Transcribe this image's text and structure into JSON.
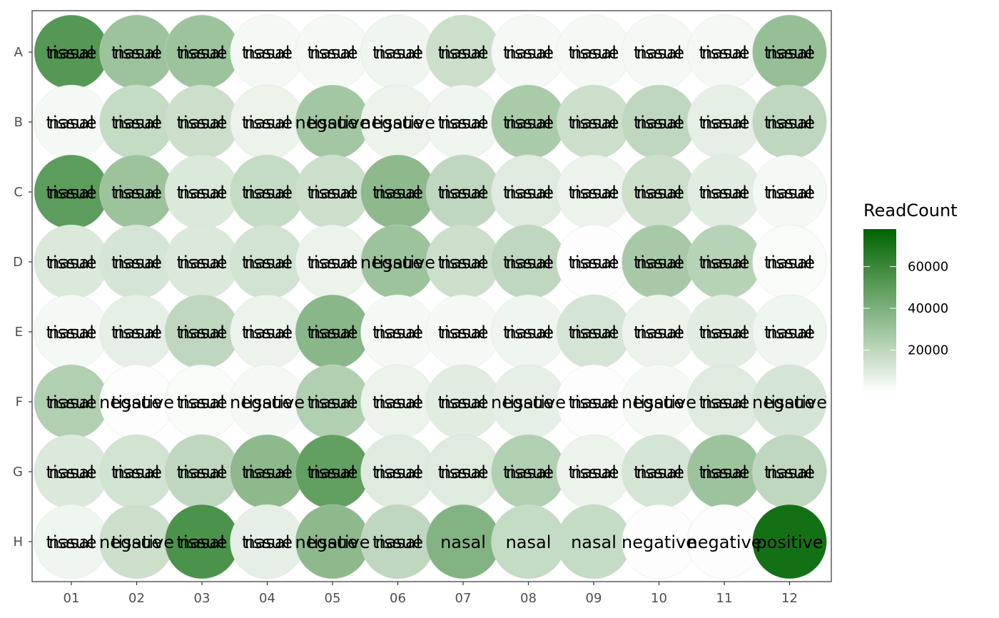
{
  "chart_data": {
    "type": "heatmap",
    "rows": [
      "A",
      "B",
      "C",
      "D",
      "E",
      "F",
      "G",
      "H"
    ],
    "columns": [
      "01",
      "02",
      "03",
      "04",
      "05",
      "06",
      "07",
      "08",
      "09",
      "10",
      "11",
      "12"
    ],
    "value_name": "ReadCount",
    "legend": {
      "title": "ReadCount",
      "ticks": [
        20000,
        40000,
        60000
      ],
      "tick_labels": [
        "20000",
        "40000",
        "60000"
      ],
      "range": [
        0,
        78000
      ],
      "color_low": "#ffffff",
      "color_high": "#006400",
      "placement": "right"
    },
    "values": [
      [
        52000,
        30000,
        30000,
        3000,
        3000,
        5000,
        16000,
        3000,
        3000,
        3000,
        3000,
        32000
      ],
      [
        3000,
        18000,
        16000,
        6000,
        28000,
        6000,
        5000,
        26000,
        16000,
        20000,
        8000,
        20000
      ],
      [
        50000,
        30000,
        11000,
        18000,
        16000,
        35000,
        20000,
        10000,
        6000,
        16000,
        9000,
        3000
      ],
      [
        11000,
        13000,
        11000,
        14000,
        6000,
        30000,
        16000,
        20000,
        1000,
        27000,
        22000,
        2000
      ],
      [
        3000,
        8000,
        20000,
        6000,
        36000,
        3000,
        3000,
        5000,
        13000,
        6000,
        9000,
        5000
      ],
      [
        24000,
        1000,
        2000,
        3000,
        24000,
        6000,
        9000,
        8000,
        1000,
        3000,
        10000,
        13000
      ],
      [
        11000,
        14000,
        20000,
        35000,
        48000,
        10000,
        10000,
        24000,
        6000,
        13000,
        30000,
        20000
      ],
      [
        5000,
        16000,
        55000,
        8000,
        35000,
        20000,
        38000,
        18000,
        18000,
        1000,
        1000,
        72000
      ]
    ],
    "labels": [
      [
        [
          "nasal",
          "tissue"
        ],
        [
          "nasal",
          "tissue"
        ],
        [
          "nasal",
          "tissue"
        ],
        [
          "nasal",
          "tissue"
        ],
        [
          "nasal",
          "tissue"
        ],
        [
          "nasal",
          "tissue"
        ],
        [
          "nasal",
          "tissue"
        ],
        [
          "nasal",
          "tissue"
        ],
        [
          "nasal",
          "tissue"
        ],
        [
          "nasal",
          "tissue"
        ],
        [
          "nasal",
          "tissue"
        ],
        [
          "nasal",
          "tissue"
        ]
      ],
      [
        [
          "nasal",
          "tissue"
        ],
        [
          "nasal",
          "tissue"
        ],
        [
          "nasal",
          "tissue"
        ],
        [
          "nasal",
          "tissue"
        ],
        [
          "negative",
          "tissue"
        ],
        [
          "negative",
          "tissue"
        ],
        [
          "nasal",
          "tissue"
        ],
        [
          "nasal",
          "tissue"
        ],
        [
          "nasal",
          "tissue"
        ],
        [
          "nasal",
          "tissue"
        ],
        [
          "nasal",
          "tissue"
        ],
        [
          "nasal",
          "tissue"
        ]
      ],
      [
        [
          "nasal",
          "tissue"
        ],
        [
          "nasal",
          "tissue"
        ],
        [
          "nasal",
          "tissue"
        ],
        [
          "nasal",
          "tissue"
        ],
        [
          "nasal",
          "tissue"
        ],
        [
          "nasal",
          "tissue"
        ],
        [
          "nasal",
          "tissue"
        ],
        [
          "nasal",
          "tissue"
        ],
        [
          "nasal",
          "tissue"
        ],
        [
          "nasal",
          "tissue"
        ],
        [
          "nasal",
          "tissue"
        ],
        [
          "nasal",
          "tissue"
        ]
      ],
      [
        [
          "nasal",
          "tissue"
        ],
        [
          "nasal",
          "tissue"
        ],
        [
          "nasal",
          "tissue"
        ],
        [
          "nasal",
          "tissue"
        ],
        [
          "nasal",
          "tissue"
        ],
        [
          "negative",
          "tissue"
        ],
        [
          "nasal",
          "tissue"
        ],
        [
          "nasal",
          "tissue"
        ],
        [
          "nasal",
          "tissue"
        ],
        [
          "nasal",
          "tissue"
        ],
        [
          "nasal",
          "tissue"
        ],
        [
          "nasal",
          "tissue"
        ]
      ],
      [
        [
          "nasal",
          "tissue"
        ],
        [
          "nasal",
          "tissue"
        ],
        [
          "nasal",
          "tissue"
        ],
        [
          "nasal",
          "tissue"
        ],
        [
          "nasal",
          "tissue"
        ],
        [
          "nasal",
          "tissue"
        ],
        [
          "nasal",
          "tissue"
        ],
        [
          "nasal",
          "tissue"
        ],
        [
          "nasal",
          "tissue"
        ],
        [
          "nasal",
          "tissue"
        ],
        [
          "nasal",
          "tissue"
        ],
        [
          "nasal",
          "tissue"
        ]
      ],
      [
        [
          "nasal",
          "tissue"
        ],
        [
          "negative",
          "tissue"
        ],
        [
          "nasal",
          "tissue"
        ],
        [
          "negative",
          "tissue"
        ],
        [
          "nasal",
          "tissue"
        ],
        [
          "nasal",
          "tissue"
        ],
        [
          "nasal",
          "tissue"
        ],
        [
          "negative",
          "tissue"
        ],
        [
          "nasal",
          "tissue"
        ],
        [
          "negative",
          "tissue"
        ],
        [
          "nasal",
          "tissue"
        ],
        [
          "negative",
          "tissue"
        ]
      ],
      [
        [
          "nasal",
          "tissue"
        ],
        [
          "nasal",
          "tissue"
        ],
        [
          "nasal",
          "tissue"
        ],
        [
          "nasal",
          "tissue"
        ],
        [
          "nasal",
          "tissue"
        ],
        [
          "nasal",
          "tissue"
        ],
        [
          "nasal",
          "tissue"
        ],
        [
          "nasal",
          "tissue"
        ],
        [
          "nasal",
          "tissue"
        ],
        [
          "nasal",
          "tissue"
        ],
        [
          "nasal",
          "tissue"
        ],
        [
          "nasal",
          "tissue"
        ]
      ],
      [
        [
          "nasal",
          "tissue"
        ],
        [
          "negative",
          "tissue"
        ],
        [
          "nasal",
          "tissue"
        ],
        [
          "nasal",
          "tissue"
        ],
        [
          "negative",
          "tissue"
        ],
        [
          "nasal",
          "tissue"
        ],
        [
          "nasal"
        ],
        [
          "nasal"
        ],
        [
          "nasal"
        ],
        [
          "negative"
        ],
        [
          "negative"
        ],
        [
          "positive"
        ]
      ]
    ]
  }
}
